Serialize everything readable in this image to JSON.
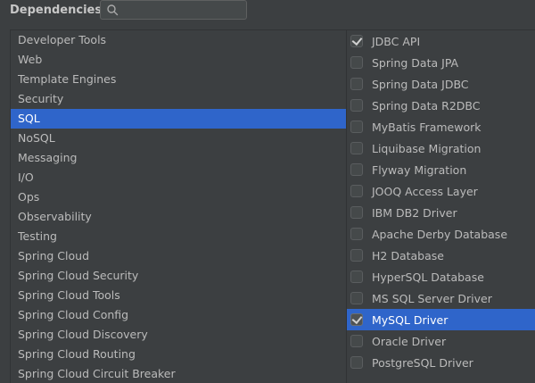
{
  "header": {
    "title": "Dependencies",
    "search_placeholder": "",
    "search_value": ""
  },
  "categories": [
    {
      "label": "Developer Tools",
      "selected": false
    },
    {
      "label": "Web",
      "selected": false
    },
    {
      "label": "Template Engines",
      "selected": false
    },
    {
      "label": "Security",
      "selected": false
    },
    {
      "label": "SQL",
      "selected": true
    },
    {
      "label": "NoSQL",
      "selected": false
    },
    {
      "label": "Messaging",
      "selected": false
    },
    {
      "label": "I/O",
      "selected": false
    },
    {
      "label": "Ops",
      "selected": false
    },
    {
      "label": "Observability",
      "selected": false
    },
    {
      "label": "Testing",
      "selected": false
    },
    {
      "label": "Spring Cloud",
      "selected": false
    },
    {
      "label": "Spring Cloud Security",
      "selected": false
    },
    {
      "label": "Spring Cloud Tools",
      "selected": false
    },
    {
      "label": "Spring Cloud Config",
      "selected": false
    },
    {
      "label": "Spring Cloud Discovery",
      "selected": false
    },
    {
      "label": "Spring Cloud Routing",
      "selected": false
    },
    {
      "label": "Spring Cloud Circuit Breaker",
      "selected": false
    }
  ],
  "dependencies": [
    {
      "label": "JDBC API",
      "checked": true,
      "selected": false
    },
    {
      "label": "Spring Data JPA",
      "checked": false,
      "selected": false
    },
    {
      "label": "Spring Data JDBC",
      "checked": false,
      "selected": false
    },
    {
      "label": "Spring Data R2DBC",
      "checked": false,
      "selected": false
    },
    {
      "label": "MyBatis Framework",
      "checked": false,
      "selected": false
    },
    {
      "label": "Liquibase Migration",
      "checked": false,
      "selected": false
    },
    {
      "label": "Flyway Migration",
      "checked": false,
      "selected": false
    },
    {
      "label": "JOOQ Access Layer",
      "checked": false,
      "selected": false
    },
    {
      "label": "IBM DB2 Driver",
      "checked": false,
      "selected": false
    },
    {
      "label": "Apache Derby Database",
      "checked": false,
      "selected": false
    },
    {
      "label": "H2 Database",
      "checked": false,
      "selected": false
    },
    {
      "label": "HyperSQL Database",
      "checked": false,
      "selected": false
    },
    {
      "label": "MS SQL Server Driver",
      "checked": false,
      "selected": false
    },
    {
      "label": "MySQL Driver",
      "checked": true,
      "selected": true
    },
    {
      "label": "Oracle Driver",
      "checked": false,
      "selected": false
    },
    {
      "label": "PostgreSQL Driver",
      "checked": false,
      "selected": false
    }
  ],
  "colors": {
    "background": "#3c3f41",
    "selection": "#2f65ca",
    "text": "#bbbbbb"
  },
  "icons": {
    "search": "search-icon",
    "checkbox_checked": "checkmark-icon"
  }
}
